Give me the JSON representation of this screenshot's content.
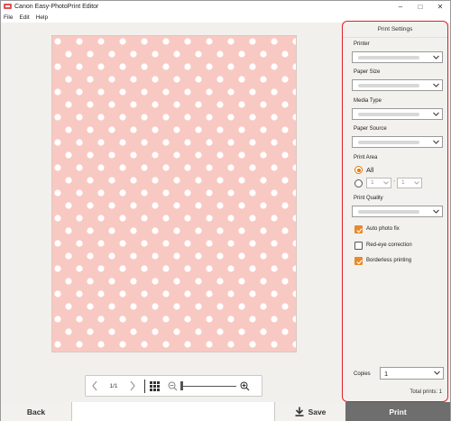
{
  "window": {
    "title": "Canon Easy-PhotoPrint Editor",
    "controls": [
      "–",
      "□",
      "✕"
    ]
  },
  "menu": [
    "File",
    "Edit",
    "Help"
  ],
  "canvas": {
    "paper_color": "#f8c9c2",
    "dot_color": "#ffffff"
  },
  "zoom_bar": {
    "page_indicator": "1/1",
    "zoom_level": 0,
    "prev_icon": "chevron-left-icon",
    "next_icon": "chevron-right-icon",
    "grid_icon": "grid-icon",
    "zoom_out_icon": "zoom-out-icon",
    "zoom_in_icon": "zoom-in-icon"
  },
  "panel": {
    "title": "Print Settings",
    "accent": "#e0202a",
    "printer_label": "Printer",
    "paper_size_label": "Paper Size",
    "media_type_label": "Media Type",
    "paper_source_label": "Paper Source",
    "print_area_label": "Print Area",
    "print_area_all": "All",
    "print_area_from": "1",
    "print_area_to": "1",
    "range_separator": "-",
    "print_quality_label": "Print Quality",
    "auto_photo_fix": "Auto photo fix",
    "auto_photo_fix_checked": true,
    "red_eye": "Red-eye correction",
    "red_eye_checked": false,
    "borderless": "Borderless printing",
    "borderless_checked": true,
    "copies_label": "Copies",
    "copies_value": "1",
    "total_prints": "Total prints: 1"
  },
  "bottom": {
    "back": "Back",
    "save": "Save",
    "print": "Print"
  }
}
